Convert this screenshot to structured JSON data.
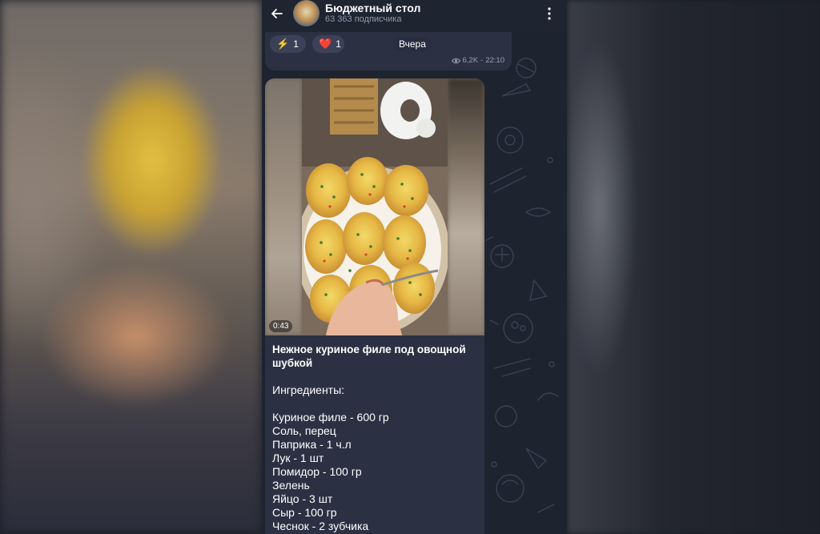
{
  "header": {
    "title": "Бюджетный стол",
    "subscribers": "63 363 подписчика"
  },
  "prev_message": {
    "reactions": [
      {
        "emoji": "⚡",
        "count": "1",
        "icon": "lightning-icon"
      },
      {
        "emoji": "❤️",
        "count": "1",
        "icon": "heart-icon"
      }
    ],
    "date_separator": "Вчера",
    "views": "6,2K",
    "time": "22:10"
  },
  "message": {
    "video_duration": "0:43",
    "title": "Нежное куриное филе под овощной шубкой",
    "ingredients_label": "Ингредиенты:",
    "ingredients": [
      "Куриное филе - 600 гр",
      "Соль, перец",
      "Паприка - 1 ч.л",
      "Лук - 1 шт",
      "Помидор - 100 гр",
      "Зелень",
      "Яйцо - 3 шт",
      "Сыр - 100 гр",
      "Чеснок - 2 зубчика"
    ]
  },
  "colors": {
    "bubble": "#2b3143",
    "background": "#1e2330",
    "text": "#ffffff"
  }
}
